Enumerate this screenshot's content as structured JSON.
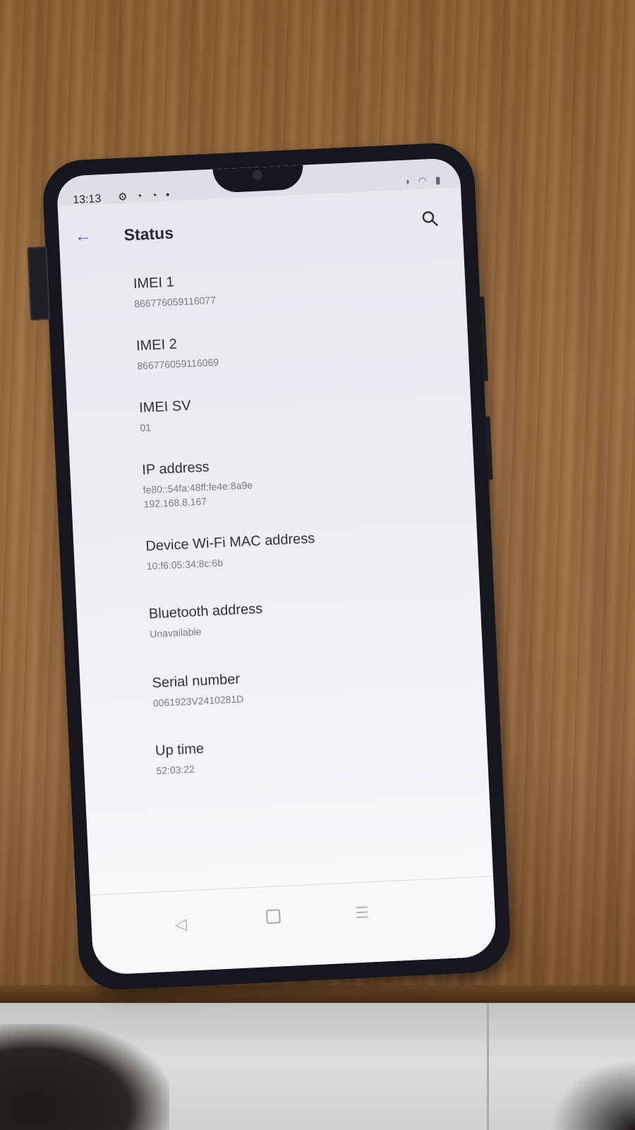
{
  "status_bar": {
    "time": "13:13",
    "left_icons": "⚙ ◔ ◔ •",
    "right_icons": "◑ ◠ ▮"
  },
  "header": {
    "title": "Status"
  },
  "items": [
    {
      "label": "IMEI 1",
      "value": "866776059116077"
    },
    {
      "label": "IMEI 2",
      "value": "866776059116069"
    },
    {
      "label": "IMEI SV",
      "value": "01"
    },
    {
      "label": "IP address",
      "value": "fe80::54fa:48ff:fe4e:8a9e",
      "value2": "192.168.8.167"
    },
    {
      "label": "Device Wi-Fi MAC address",
      "value": "10:f6:05:34:8c:6b"
    },
    {
      "label": "Bluetooth address",
      "value": "Unavailable"
    },
    {
      "label": "Serial number",
      "value": "0061923V2410281D"
    },
    {
      "label": "Up time",
      "value": "52:03:22"
    }
  ],
  "nav_bar": {
    "back_glyph": "◁",
    "menu_glyph": "☰"
  },
  "colors": {
    "accent": "#4a5cc7",
    "screen_bg": "#ececf3",
    "phone_frame": "#15161e"
  }
}
